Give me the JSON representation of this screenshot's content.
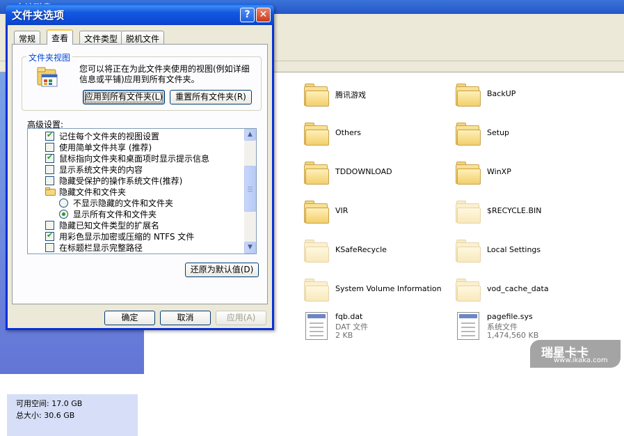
{
  "background_window": {
    "title": "本地磁盘 (E:)",
    "details": {
      "free_space": "可用空间: 17.0 GB",
      "total_size": "总大小: 30.6 GB"
    },
    "items": [
      {
        "name": "腾讯游戏",
        "kind": "folder",
        "hidden": false
      },
      {
        "name": "BackUP",
        "kind": "folder",
        "hidden": false
      },
      {
        "name": "Others",
        "kind": "folder",
        "hidden": false
      },
      {
        "name": "Setup",
        "kind": "folder",
        "hidden": false
      },
      {
        "name": "TDDOWNLOAD",
        "kind": "folder",
        "hidden": false
      },
      {
        "name": "WinXP",
        "kind": "folder",
        "hidden": false
      },
      {
        "name": "VIR",
        "kind": "folder",
        "hidden": false
      },
      {
        "name": "$RECYCLE.BIN",
        "kind": "folder",
        "hidden": true
      },
      {
        "name": "KSafeRecycle",
        "kind": "folder",
        "hidden": true
      },
      {
        "name": "Local Settings",
        "kind": "folder",
        "hidden": true
      },
      {
        "name": "System Volume Information",
        "kind": "folder",
        "hidden": true
      },
      {
        "name": "vod_cache_data",
        "kind": "folder",
        "hidden": true
      },
      {
        "name": "fqb.dat",
        "kind": "file",
        "type": "DAT 文件",
        "size": "2 KB"
      },
      {
        "name": "pagefile.sys",
        "kind": "file",
        "type": "系统文件",
        "size": "1,474,560 KB"
      }
    ]
  },
  "dialog": {
    "title": "文件夹选项",
    "help_button": "?",
    "close_button": "✕",
    "tabs": [
      {
        "label": "常规",
        "active": false
      },
      {
        "label": "查看",
        "active": true
      },
      {
        "label": "文件类型",
        "active": false
      },
      {
        "label": "脱机文件",
        "active": false
      }
    ],
    "folder_views": {
      "legend": "文件夹视图",
      "description": "您可以将正在为此文件夹使用的视图(例如详细信息或平铺)应用到所有文件夹。",
      "apply_button": "应用到所有文件夹(L)",
      "reset_button": "重置所有文件夹(R)"
    },
    "advanced_label": "高级设置:",
    "settings": [
      {
        "type": "checkbox",
        "checked": true,
        "label": "记住每个文件夹的视图设置",
        "indent": 0
      },
      {
        "type": "checkbox",
        "checked": false,
        "label": "使用简单文件共享 (推荐)",
        "indent": 0
      },
      {
        "type": "checkbox",
        "checked": true,
        "label": "鼠标指向文件夹和桌面项时显示提示信息",
        "indent": 0
      },
      {
        "type": "checkbox",
        "checked": false,
        "label": "显示系统文件夹的内容",
        "indent": 0
      },
      {
        "type": "checkbox",
        "checked": false,
        "label": "隐藏受保护的操作系统文件(推荐)",
        "indent": 0
      },
      {
        "type": "folder",
        "checked": false,
        "label": "隐藏文件和文件夹",
        "indent": 0
      },
      {
        "type": "radio",
        "checked": false,
        "label": "不显示隐藏的文件和文件夹",
        "indent": 1
      },
      {
        "type": "radio",
        "checked": true,
        "label": "显示所有文件和文件夹",
        "indent": 1
      },
      {
        "type": "checkbox",
        "checked": false,
        "label": "隐藏已知文件类型的扩展名",
        "indent": 0
      },
      {
        "type": "checkbox",
        "checked": true,
        "label": "用彩色显示加密或压缩的 NTFS 文件",
        "indent": 0
      },
      {
        "type": "checkbox",
        "checked": false,
        "label": "在标题栏显示完整路径",
        "indent": 0
      }
    ],
    "restore_defaults_button": "还原为默认值(D)",
    "ok_button": "确定",
    "cancel_button": "取消",
    "apply_button": "应用(A)"
  },
  "watermark": {
    "brand": "瑞星卡卡",
    "url": "www.ikaka.com"
  }
}
